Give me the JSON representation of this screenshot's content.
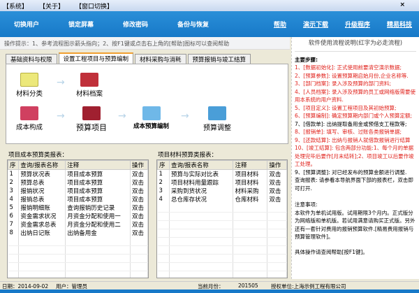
{
  "menu": [
    "【系统】",
    "【关于】",
    "【窗口切换】"
  ],
  "close": "×",
  "toolbar": {
    "left": [
      "切换用户",
      "锁定屏幕",
      "修改密码",
      "备份与恢复"
    ],
    "right": [
      "帮助",
      "演示下载",
      "升级程序",
      "精易科技"
    ]
  },
  "hint": "操作提示：1、参考流程图示箭头指向；2、按F1键或点击右上角的[帮助]图标可以查阅帮助",
  "tabs": [
    "基础资料与权限",
    "设置工程项目与预算编制",
    "材料采购与消耗",
    "预算报销与竣工结算"
  ],
  "flow": {
    "row1": [
      "材料分类",
      "材料档案"
    ],
    "row2": [
      "成本构成",
      "预算项目",
      "成本预算编制",
      "预算调整"
    ],
    "arrow": "→"
  },
  "left_table": {
    "caption": "项目成本预算类报表：",
    "headers": [
      "序",
      "查询/报表名称",
      "注释",
      "操作"
    ],
    "rows": [
      [
        "1",
        "预算状况表",
        "项目成本预算",
        "双击"
      ],
      [
        "2",
        "预算总表",
        "项目成本预算",
        "双击"
      ],
      [
        "3",
        "报销状况",
        "项目成本预算",
        "双击"
      ],
      [
        "4",
        "报销总表",
        "项目成本预算",
        "双击"
      ],
      [
        "5",
        "报销明细账",
        "查询报销历史记录",
        "双击"
      ],
      [
        "6",
        "资金需求状况",
        "月资金分配和使用一",
        "双击"
      ],
      [
        "7",
        "资金需求总表",
        "月资金分配和使用二",
        "双击"
      ],
      [
        "8",
        "出纳日记账",
        "出纳备用金",
        "双击"
      ]
    ]
  },
  "right_table": {
    "caption": "项目材料预算类报表：",
    "headers": [
      "序",
      "查询/报表名称",
      "注释",
      "操作"
    ],
    "rows": [
      [
        "1",
        "预算与实际对比表",
        "项目材料",
        "双击"
      ],
      [
        "2",
        "项目材料用量跟踪",
        "项目材料",
        "双击"
      ],
      [
        "3",
        "采购到货状况",
        "材料采购",
        "双击"
      ],
      [
        "4",
        "总仓库存状况",
        "仓库材料",
        "双击"
      ]
    ]
  },
  "side": {
    "title": "软件使用流程说明(红字为必走流程)",
    "heading": "主要步骤:",
    "steps": [
      {
        "t": "1、[数据初始化]: 正式使用前要清空演示数据;",
        "red": true
      },
      {
        "t": "2、[预算参数]: 设置预算期启始月份,企业名称等.",
        "red": true
      },
      {
        "t": "3、[部门档案]: 录入涉及预算的部门资料;",
        "red": true
      },
      {
        "t": "4、[人员档案]: 录入涉及预算的员工或网络版需要使用本系统的用户资料.",
        "red": true
      },
      {
        "t": "5、[项目定义]: 设置工程项目及其初始预算;",
        "red": true
      },
      {
        "t": "6、[预算编制]: 确定预算期内部门或个人预算定额;",
        "red": true
      },
      {
        "t": "7、[借款单]: 出纳提取备用金或预借支工程款等;",
        "red": false
      },
      {
        "t": "8、[报销单]: 填写、审核、过账各类报销单据;",
        "red": true
      },
      {
        "t": "9、[还款结算]: 出纳与报销人就借款报销进行结算",
        "red": true
      },
      {
        "t": "10、[竣工结算]: 包含两部分功能:1、每个月的单据处理完毕后要作[月末结转];2、项目竣工以后要作竣工处理。",
        "red": true
      },
      {
        "t": "9、[预算调整]: 对已经发布的预算金额进行调整.",
        "red": false
      },
      {
        "t": "查询报表: 请参看本导航界面下部的报表栏，双击即可打开.",
        "red": false
      }
    ],
    "notes_heading": "注意事项:",
    "notes": "本软件为单机试用版。试用期限3个月内。正式版分为网络版和单机版。若试用满意请购买正式版。另外还有一套针对费用的报销预算软件.[精易费用报销与预算管理软件]。",
    "help": "具体操作请查阅帮助[按F1键]。"
  },
  "status": {
    "date": "日期：2014-09-02",
    "user": "用户：管理员",
    "month_label": "当前月份：",
    "month": "201505",
    "org": "授权单位:上海示例工程有限公司"
  }
}
